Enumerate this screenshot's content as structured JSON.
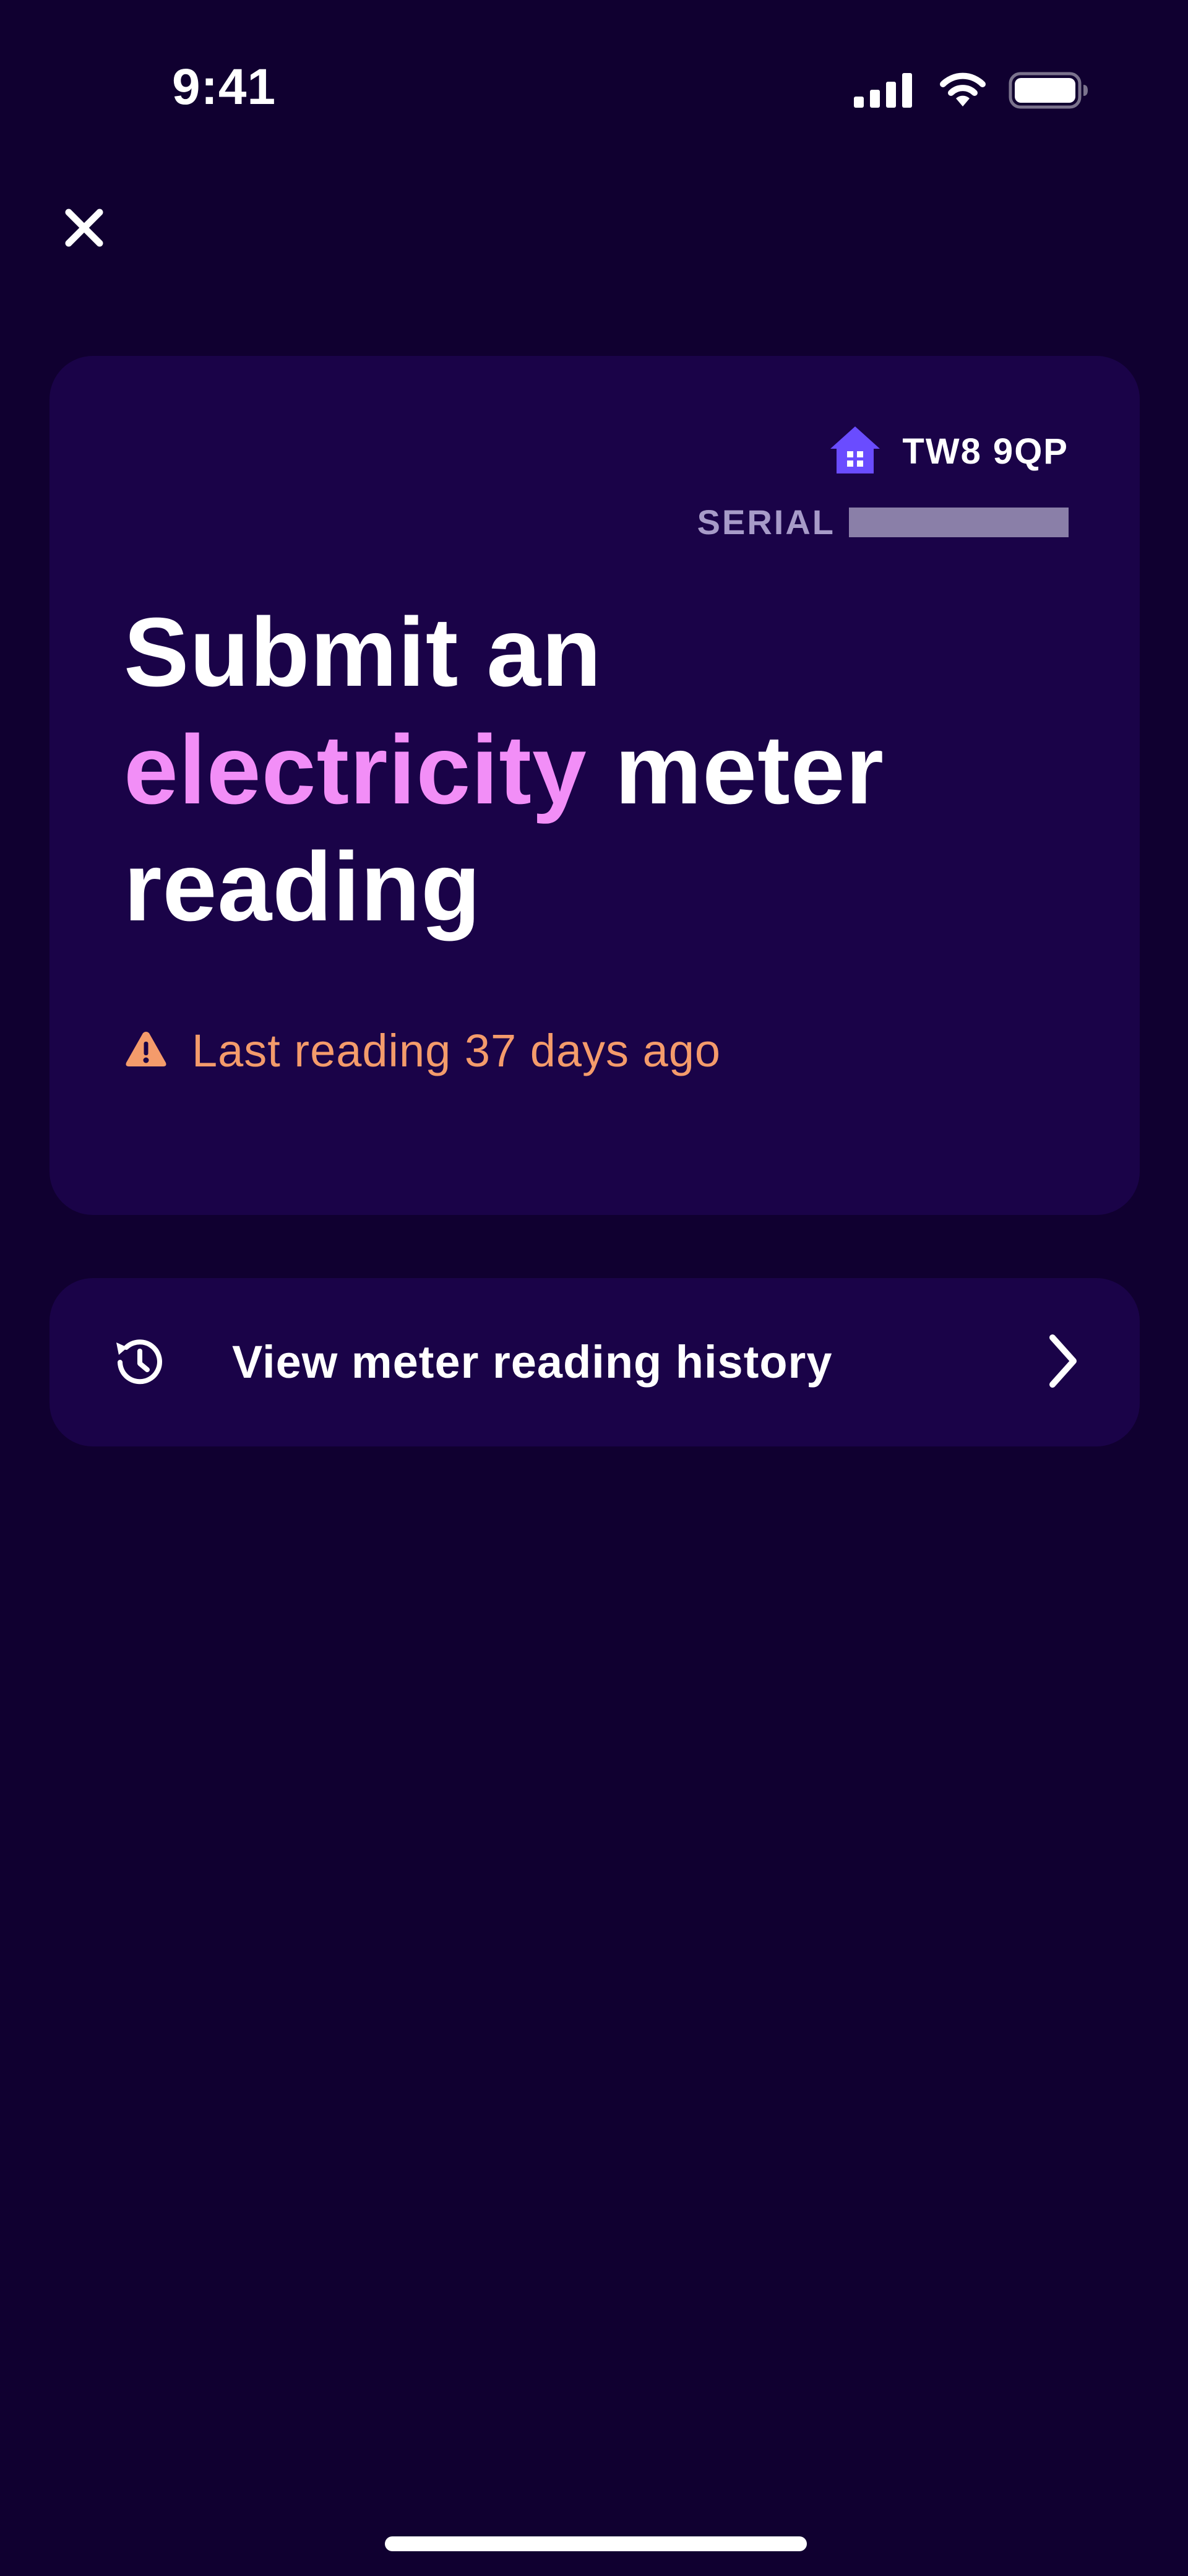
{
  "status_bar": {
    "time": "9:41",
    "icons": [
      "signal-icon",
      "wifi-icon",
      "battery-icon"
    ]
  },
  "header": {
    "close_icon": "close-icon"
  },
  "meter_card": {
    "location_icon": "house-icon",
    "postcode": "TW8 9QP",
    "serial_label": "SERIAL",
    "serial_value": "",
    "title_part1": "Submit an ",
    "title_highlight": "electricity",
    "title_part2": " meter reading",
    "warning_icon": "warning-icon",
    "warning_text": "Last reading 37 days ago"
  },
  "history": {
    "icon": "history-icon",
    "label": "View meter reading history",
    "chevron": "chevron-right-icon"
  },
  "colors": {
    "background": "#100030",
    "card": "#1a0348",
    "highlight": "#f28ef7",
    "warning": "#f49b6b",
    "house_icon": "#6a4cff",
    "muted_text": "#a79bc8"
  }
}
